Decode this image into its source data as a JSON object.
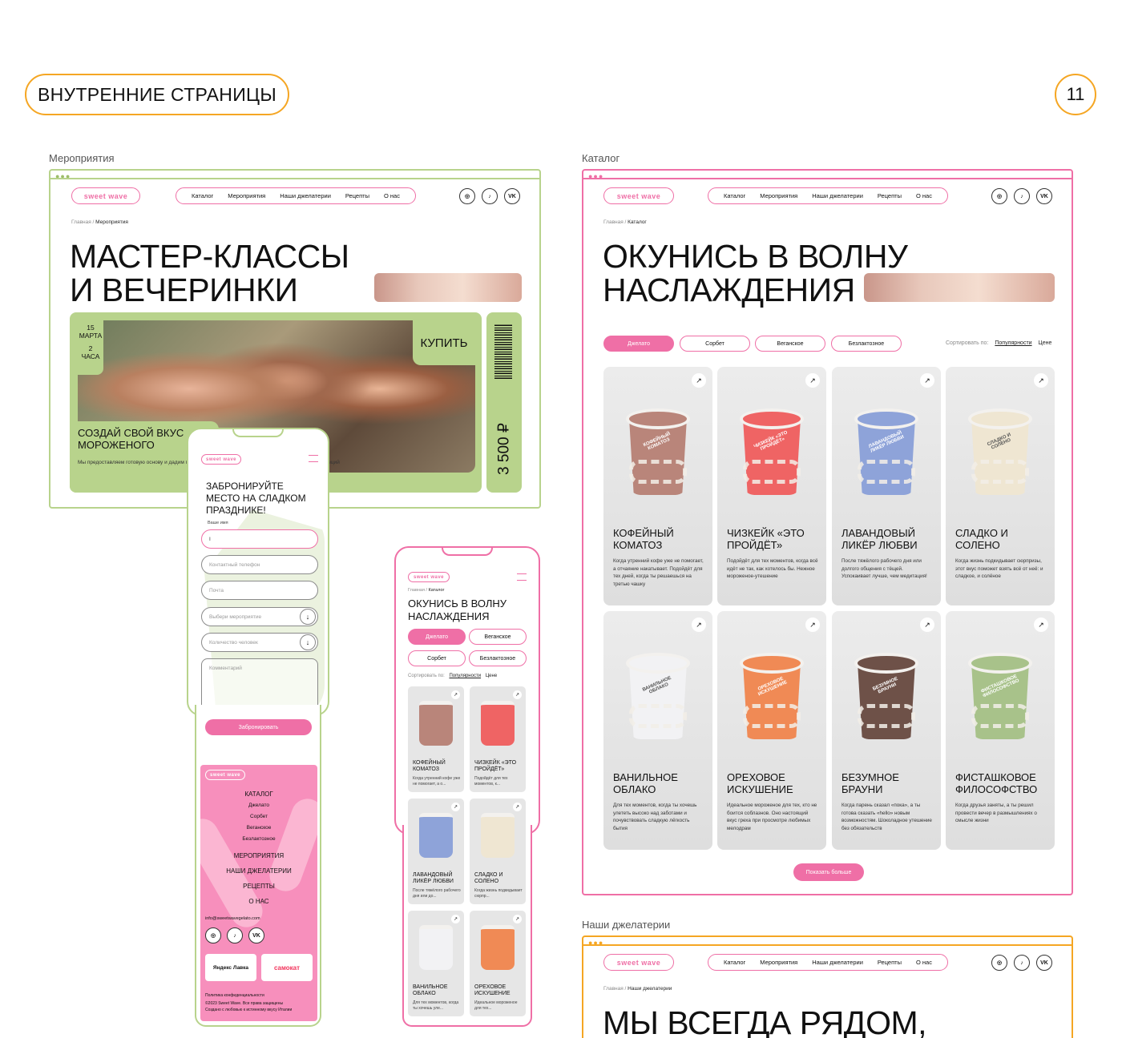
{
  "header": {
    "section_badge": "ВНУТРЕННИЕ СТРАНИЦЫ",
    "page_number": "11"
  },
  "colors": {
    "green": "#b8d38c",
    "pink": "#ef6fa6",
    "orange": "#f5a623"
  },
  "labels": {
    "events": "Мероприятия",
    "catalog": "Каталог",
    "gelaterias": "Наши джелатерии"
  },
  "site": {
    "brand": "sweet wave",
    "nav": [
      "Каталог",
      "Мероприятия",
      "Наши джелатерии",
      "Рецепты",
      "О нас"
    ],
    "social": [
      "instagram-icon",
      "tiktok-icon",
      "vk-icon"
    ],
    "social_text": [
      "◎",
      "♪",
      "VK"
    ],
    "crumb_home": "Главная"
  },
  "events_page": {
    "crumb_current": "Мероприятия",
    "title_line1": "МАСТЕР-КЛАССЫ",
    "title_line2": "И ВЕЧЕРИНКИ",
    "ticket": {
      "day": "15",
      "month": "МАРТА",
      "hours_num": "2",
      "hours_label": "ЧАСА",
      "buy": "КУПИТЬ",
      "price": "3 500 ₽",
      "title": "СОЗДАЙ СВОЙ ВКУС МОРОЖЕНОГО",
      "desc": "Мы предоставляем готовую основу и дадим палитру ингредиентов: от экзотических... до необычных специй"
    }
  },
  "catalog_page": {
    "crumb_current": "Каталог",
    "title_line1": "ОКУНИСЬ В ВОЛНУ",
    "title_line2": "НАСЛАЖДЕНИЯ",
    "filters": [
      "Джелато",
      "Сорбет",
      "Веганское",
      "Безлактозное"
    ],
    "sort_label": "Сортировать по:",
    "sort_options": [
      "Популярности",
      "Цене"
    ],
    "arrow": "↗",
    "products": [
      {
        "title": "КОФЕЙНЫЙ КОМАТОЗ",
        "desc": "Когда утренний кофе уже не помогает, а отчаяние накатывает. Подойдёт для тех дней, когда ты решаешься на третью чашку",
        "color": "#b9857a"
      },
      {
        "title": "ЧИЗКЕЙК «ЭТО ПРОЙДЁТ»",
        "desc": "Подойдёт для тех моментов, когда всё идёт не так, как хотелось бы. Нежное мороженое-утешение",
        "color": "#ef6464"
      },
      {
        "title": "ЛАВАНДОВЫЙ ЛИКЁР ЛЮБВИ",
        "desc": "После тяжёлого рабочего дня или долгого общения с тёщей. Успокаивает лучше, чем медитация!",
        "color": "#8ea3d9"
      },
      {
        "title": "СЛАДКО И СОЛЕНО",
        "desc": "Когда жизнь подкидывает сюрпризы, этот вкус поможет взять всё от неё: и сладкое, и солёное",
        "color": "#efe6d2"
      },
      {
        "title": "ВАНИЛЬНОЕ ОБЛАКО",
        "desc": "Для тех моментов, когда ты хочешь улететь высоко над заботами и почувствовать сладкую лёгкость бытия",
        "color": "#f2f2f4"
      },
      {
        "title": "ОРЕХОВОЕ ИСКУШЕНИЕ",
        "desc": "Идеальное мороженое для тех, кто не боится соблазнов. Оно настоящий вкус греха при просмотре любимых мелодрам",
        "color": "#f08a55"
      },
      {
        "title": "БЕЗУМНОЕ БРАУНИ",
        "desc": "Когда парень сказал «пока», а ты готова сказать «hello» новым возможностям. Шоколадное утешение без обязательств",
        "color": "#6e5148"
      },
      {
        "title": "ФИСТАШКОВОЕ ФИЛОСОФСТВО",
        "desc": "Когда друзья заняты, а ты решил провести вечер в размышлениях о смысле жизни",
        "color": "#a8c28a"
      }
    ],
    "show_more": "Показать больше"
  },
  "gelaterias_page": {
    "crumb_current": "Наши джелатерии",
    "title_line1": "МЫ ВСЕГДА РЯДОМ,"
  },
  "mobile_booking": {
    "title": "ЗАБРОНИРУЙТЕ МЕСТО НА СЛАДКОМ ПРАЗДНИКЕ!",
    "name_label": "Ваше имя",
    "name_value": "I",
    "phone": "Контактный телефон",
    "email": "Почта",
    "event": "Выбери мероприятие",
    "people": "Количество человек",
    "comment": "Комментарий",
    "submit": "Забронировать"
  },
  "mobile_footer": {
    "catalog": "КАТАЛОГ",
    "sub": [
      "Джелато",
      "Сорбет",
      "Веганское",
      "Безлактозное"
    ],
    "links": [
      "МЕРОПРИЯТИЯ",
      "НАШИ ДЖЕЛАТЕРИИ",
      "РЕЦЕПТЫ",
      "О НАС"
    ],
    "email": "info@sweetwavegelato.com",
    "partner1": "Яндекс Лавка",
    "partner2": "самокат",
    "privacy": "Политика конфиденциальности",
    "copyright": "©2023 Sweet Wave. Все права защищены",
    "made": "Создано с любовью к истинному вкусу Италии"
  },
  "mobile_catalog": {
    "title": "ОКУНИСЬ В ВОЛНУ НАСЛАЖДЕНИЯ",
    "filters": [
      "Джелато",
      "Веганское",
      "Сорбет",
      "Безлактозное"
    ],
    "products": [
      {
        "title": "КОФЕЙНЫЙ КОМАТОЗ",
        "desc": "Когда утренний кофе уже не помогает, а о...",
        "color": "#b9857a"
      },
      {
        "title": "ЧИЗКЕЙК «ЭТО ПРОЙДЁТ»",
        "desc": "Подойдёт для тех моментов, к...",
        "color": "#ef6464"
      },
      {
        "title": "ЛАВАНДОВЫЙ ЛИКЁР ЛЮБВИ",
        "desc": "После тяжёлого рабочего дня или до...",
        "color": "#8ea3d9"
      },
      {
        "title": "СЛАДКО И СОЛЕНО",
        "desc": "Когда жизнь подкидывает сюрпр...",
        "color": "#efe6d2"
      },
      {
        "title": "ВАНИЛЬНОЕ ОБЛАКО",
        "desc": "Для тех моментов, когда ты хочешь уле...",
        "color": "#f2f2f4"
      },
      {
        "title": "ОРЕХОВОЕ ИСКУШЕНИЕ",
        "desc": "Идеальное мороженое для тех...",
        "color": "#f08a55"
      }
    ]
  }
}
